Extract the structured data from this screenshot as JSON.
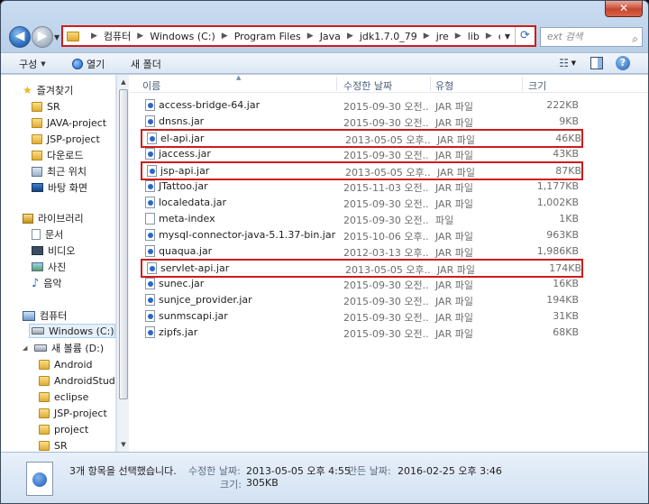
{
  "window": {
    "close_glyph": "✕"
  },
  "address": {
    "crumbs": [
      "컴퓨터",
      "Windows (C:)",
      "Program Files",
      "Java",
      "jdk1.7.0_79",
      "jre",
      "lib",
      "ext"
    ],
    "search_placeholder": "ext 검색"
  },
  "toolbar": {
    "organize": "구성",
    "open": "열기",
    "new_folder": "새 폴더"
  },
  "nav": {
    "favorites": "즐겨찾기",
    "fav_items": [
      "SR",
      "JAVA-project",
      "JSP-project",
      "다운로드",
      "최근 위치",
      "바탕 화면"
    ],
    "libraries": "라이브러리",
    "lib_items": [
      "문서",
      "비디오",
      "사진",
      "음악"
    ],
    "computer": "컴퓨터",
    "drive_c": "Windows (C:)",
    "drive_d": "새 볼륨 (D:)",
    "d_items": [
      "Android",
      "AndroidStudio",
      "eclipse",
      "JSP-project",
      "project",
      "SR"
    ]
  },
  "columns": {
    "name": "이름",
    "date": "수정한 날짜",
    "type": "유형",
    "size": "크기"
  },
  "files": [
    {
      "name": "access-bridge-64.jar",
      "date": "2015-09-30 오전...",
      "type": "JAR 파일",
      "size": "222KB",
      "hl": false,
      "plain": false
    },
    {
      "name": "dnsns.jar",
      "date": "2015-09-30 오전...",
      "type": "JAR 파일",
      "size": "9KB",
      "hl": false,
      "plain": false
    },
    {
      "name": "el-api.jar",
      "date": "2013-05-05 오후...",
      "type": "JAR 파일",
      "size": "46KB",
      "hl": true,
      "plain": false
    },
    {
      "name": "jaccess.jar",
      "date": "2015-09-30 오전...",
      "type": "JAR 파일",
      "size": "43KB",
      "hl": false,
      "plain": false
    },
    {
      "name": "jsp-api.jar",
      "date": "2013-05-05 오후...",
      "type": "JAR 파일",
      "size": "87KB",
      "hl": true,
      "plain": false
    },
    {
      "name": "JTattoo.jar",
      "date": "2015-11-03 오전...",
      "type": "JAR 파일",
      "size": "1,177KB",
      "hl": false,
      "plain": false
    },
    {
      "name": "localedata.jar",
      "date": "2015-09-30 오전...",
      "type": "JAR 파일",
      "size": "1,002KB",
      "hl": false,
      "plain": false
    },
    {
      "name": "meta-index",
      "date": "2015-09-30 오전...",
      "type": "파일",
      "size": "1KB",
      "hl": false,
      "plain": true
    },
    {
      "name": "mysql-connector-java-5.1.37-bin.jar",
      "date": "2015-10-06 오후...",
      "type": "JAR 파일",
      "size": "963KB",
      "hl": false,
      "plain": false
    },
    {
      "name": "quaqua.jar",
      "date": "2012-03-13 오후...",
      "type": "JAR 파일",
      "size": "1,986KB",
      "hl": false,
      "plain": false
    },
    {
      "name": "servlet-api.jar",
      "date": "2013-05-05 오후...",
      "type": "JAR 파일",
      "size": "174KB",
      "hl": true,
      "plain": false
    },
    {
      "name": "sunec.jar",
      "date": "2015-09-30 오전...",
      "type": "JAR 파일",
      "size": "16KB",
      "hl": false,
      "plain": false
    },
    {
      "name": "sunjce_provider.jar",
      "date": "2015-09-30 오전...",
      "type": "JAR 파일",
      "size": "194KB",
      "hl": false,
      "plain": false
    },
    {
      "name": "sunmscapi.jar",
      "date": "2015-09-30 오전...",
      "type": "JAR 파일",
      "size": "31KB",
      "hl": false,
      "plain": false
    },
    {
      "name": "zipfs.jar",
      "date": "2015-09-30 오전...",
      "type": "JAR 파일",
      "size": "68KB",
      "hl": false,
      "plain": false
    }
  ],
  "details": {
    "selection": "3개 항목을 선택했습니다.",
    "modified_label": "수정한 날짜:",
    "modified_value": "2013-05-05 오후 4:55",
    "created_label": "만든 날짜:",
    "created_value": "2016-02-25 오후 3:46",
    "size_label": "크기:",
    "size_value": "305KB"
  }
}
